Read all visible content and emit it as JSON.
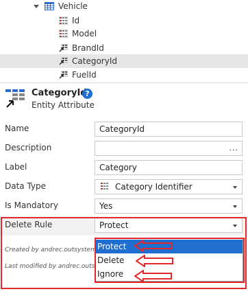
{
  "tree": {
    "entity": "Vehicle",
    "attributes": [
      {
        "name": "Id",
        "kind": "plain"
      },
      {
        "name": "Model",
        "kind": "plain"
      },
      {
        "name": "BrandId",
        "kind": "reference"
      },
      {
        "name": "CategoryId",
        "kind": "reference",
        "selected": true
      },
      {
        "name": "FuelId",
        "kind": "reference"
      }
    ]
  },
  "header": {
    "title": "CategoryId",
    "subtitle": "Entity Attribute",
    "help": "?"
  },
  "properties": {
    "name_label": "Name",
    "name_value": "CategoryId",
    "description_label": "Description",
    "description_value": "",
    "description_button": "...",
    "label_label": "Label",
    "label_value": "Category",
    "data_type_label": "Data Type",
    "data_type_value": "Category Identifier",
    "mandatory_label": "Is Mandatory",
    "mandatory_value": "Yes",
    "delete_rule_label": "Delete Rule",
    "delete_rule_value": "Protect"
  },
  "meta": {
    "created_by": "Created by andrec.outsystems",
    "modified_by": "Last modified by andrec.outsy"
  },
  "dropdown": {
    "options": [
      "Protect",
      "Delete",
      "Ignore"
    ],
    "highlighted": "Protect"
  },
  "colors": {
    "accent": "#1f6fd1",
    "annotation": "#e3262a",
    "selected_row": "#e6e6e6"
  }
}
